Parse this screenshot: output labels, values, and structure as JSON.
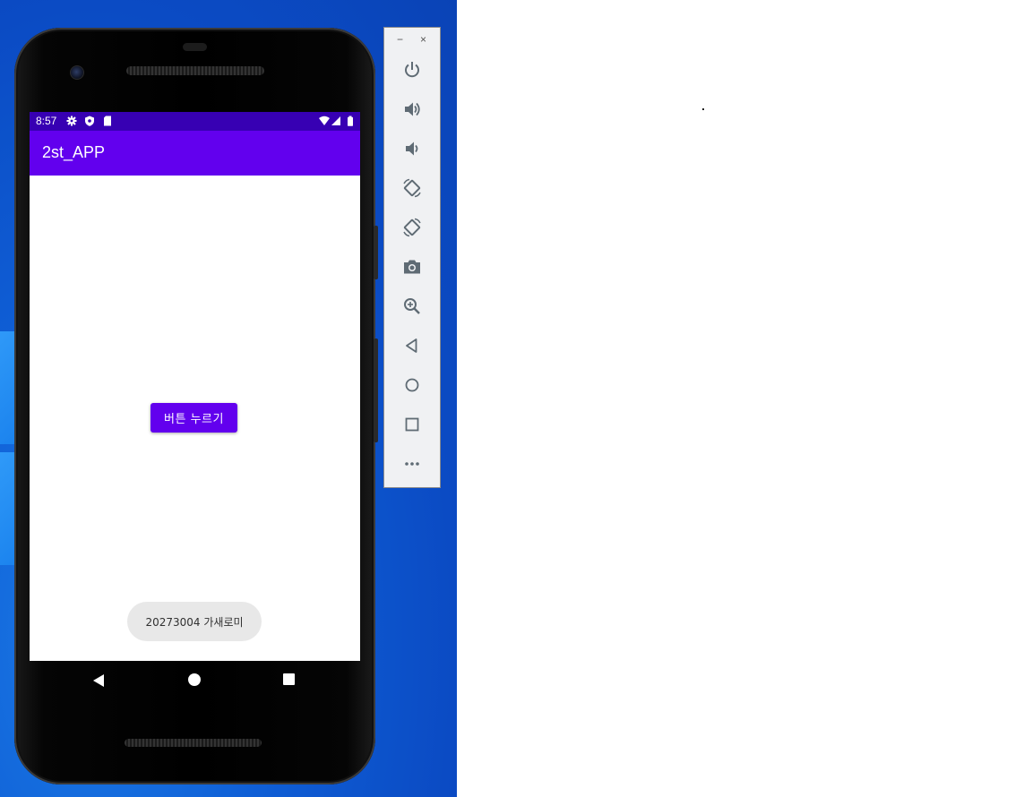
{
  "status_bar": {
    "time": "8:57",
    "left_icons": [
      "gear-icon",
      "shield-icon",
      "sd-card-icon"
    ],
    "right_icons": [
      "wifi-icon",
      "signal-icon",
      "battery-icon"
    ]
  },
  "app": {
    "title": "2st_APP",
    "button_label": "버튼 누르기",
    "toast_message": "20273004 가새로미"
  },
  "colors": {
    "primary": "#6200ee",
    "primary_dark": "#3700b3",
    "toast_bg": "#e8e8e8"
  },
  "nav_bar": {
    "buttons": [
      "back-icon",
      "home-icon",
      "recents-icon"
    ]
  },
  "emulator_toolbar": {
    "window_controls": [
      "−",
      "×"
    ],
    "buttons": [
      "power-icon",
      "volume-up-icon",
      "volume-down-icon",
      "rotate-left-icon",
      "rotate-right-icon",
      "camera-icon",
      "zoom-icon",
      "back-icon",
      "home-icon",
      "overview-icon",
      "more-icon"
    ]
  }
}
